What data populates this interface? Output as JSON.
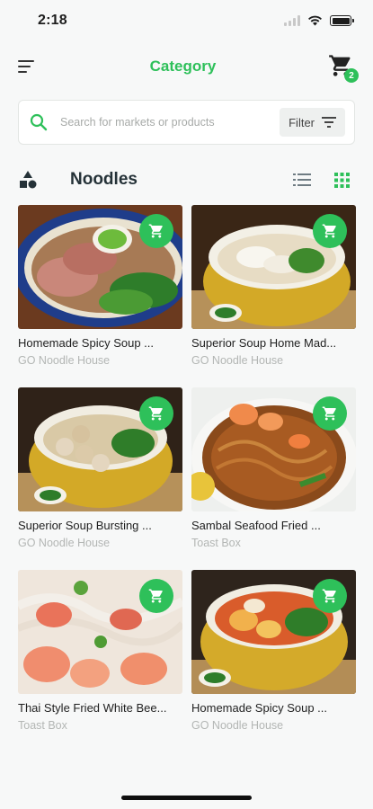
{
  "status_bar": {
    "time": "2:18"
  },
  "header": {
    "title": "Category",
    "cart_count": "2"
  },
  "search": {
    "placeholder": "Search for markets or products",
    "filter_label": "Filter"
  },
  "section": {
    "title": "Noodles"
  },
  "products": [
    {
      "title": "Homemade Spicy Soup ...",
      "shop": "GO Noodle House"
    },
    {
      "title": "Superior Soup Home Mad...",
      "shop": "GO Noodle House"
    },
    {
      "title": "Superior Soup Bursting ...",
      "shop": "GO Noodle House"
    },
    {
      "title": "Sambal Seafood Fried ...",
      "shop": "Toast Box"
    },
    {
      "title": "Thai Style Fried White Bee...",
      "shop": "Toast Box"
    },
    {
      "title": "Homemade Spicy Soup ...",
      "shop": "GO Noodle House"
    }
  ],
  "colors": {
    "accent": "#2ec05a",
    "muted_text": "#b3b6b4"
  },
  "icons": {
    "menu": "sort-menu-icon",
    "cart": "shopping-cart-icon",
    "search": "search-icon",
    "filter": "filter-icon",
    "category": "shapes-icon",
    "list_view": "list-view-icon",
    "grid_view": "grid-view-icon",
    "add_to_cart": "add-to-cart-icon"
  }
}
